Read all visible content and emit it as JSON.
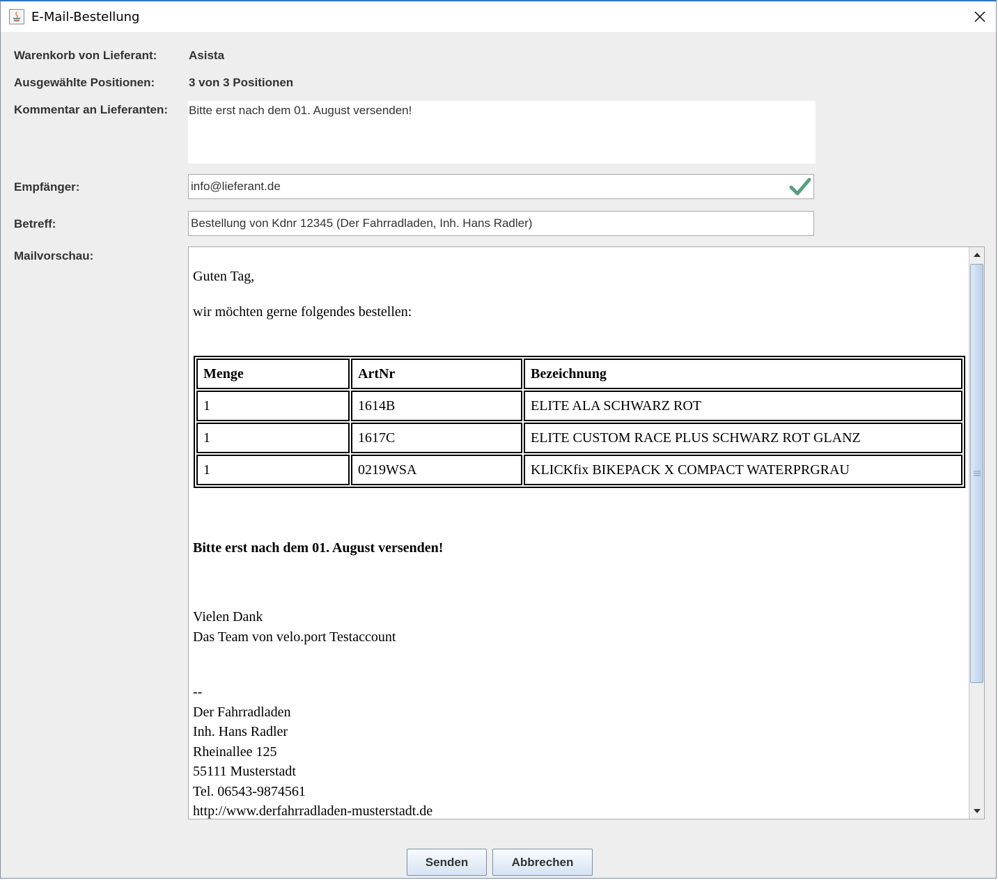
{
  "window": {
    "title": "E-Mail-Bestellung"
  },
  "form": {
    "supplier_label": "Warenkorb von Lieferant:",
    "supplier_value": "Asista",
    "positions_label": "Ausgewählte Positionen:",
    "positions_value": "3 von 3 Positionen",
    "comment_label": "Kommentar an Lieferanten:",
    "comment_value": "Bitte erst nach dem 01. August versenden!",
    "recipient_label": "Empfänger:",
    "recipient_value": "info@lieferant.de",
    "subject_label": "Betreff:",
    "subject_value": "Bestellung von Kdnr 12345 (Der Fahrradladen, Inh. Hans Radler)",
    "preview_label": "Mailvorschau:"
  },
  "preview": {
    "greeting": "Guten Tag,",
    "intro": "wir möchten gerne folgendes bestellen:",
    "table": {
      "headers": [
        "Menge",
        "ArtNr",
        "Bezeichnung"
      ],
      "rows": [
        [
          "1",
          "1614B",
          "ELITE ALA SCHWARZ ROT"
        ],
        [
          "1",
          "1617C",
          "ELITE CUSTOM RACE PLUS SCHWARZ ROT GLANZ"
        ],
        [
          "1",
          "0219WSA",
          "KLICKfix BIKEPACK X COMPACT WATERPRGRAU"
        ]
      ]
    },
    "comment": "Bitte erst nach dem 01. August versenden!",
    "thanks": "Vielen Dank",
    "team": "Das Team von velo.port Testaccount",
    "sig_separator": "--",
    "sig_lines": [
      "Der Fahrradladen",
      "Inh. Hans Radler",
      "Rheinallee 125",
      "55111 Musterstadt",
      "Tel. 06543-9874561",
      "http://www.derfahrradladen-musterstadt.de"
    ]
  },
  "buttons": {
    "send": "Senden",
    "cancel": "Abbrechen"
  },
  "icons": {
    "app": "java-icon",
    "close": "close-icon",
    "valid": "checkmark-icon",
    "scroll_up": "arrow-up-icon",
    "scroll_down": "arrow-down-icon",
    "grip": "grip-icon"
  },
  "colors": {
    "titlebar_accent": "#2b73c5",
    "check_green": "#5a9e7b",
    "scroll_thumb": "#bcd0e8"
  }
}
